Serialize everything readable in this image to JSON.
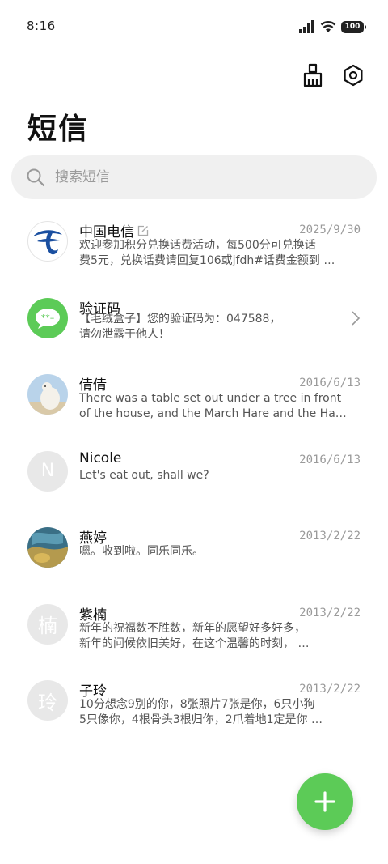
{
  "status": {
    "time": "8:16",
    "battery": "100"
  },
  "header": {
    "title": "短信"
  },
  "search": {
    "placeholder": "搜索短信"
  },
  "conversations": [
    {
      "name": "中国电信",
      "date": "2025/9/30",
      "line1": "欢迎参加积分兑换话费活动，每500分可兑换话",
      "line2": "费5元，兑换话费请回复106或jfdh#话费金额到 …"
    },
    {
      "name": "验证码",
      "date": "",
      "line1": "【毛绒盒子】您的验证码为：047588，",
      "line2": "请勿泄露于他人！"
    },
    {
      "name": "倩倩",
      "date": "2016/6/13",
      "line1": "There was a table set out under a tree in front",
      "line2": "of the house, and the March Hare and the Hatt …"
    },
    {
      "name": "Nicole",
      "date": "2016/6/13",
      "initial": "N",
      "line1": "Let's eat out, shall we?",
      "line2": ""
    },
    {
      "name": "燕婷",
      "date": "2013/2/22",
      "line1": "嗯。收到啦。同乐同乐。",
      "line2": ""
    },
    {
      "name": "紫楠",
      "date": "2013/2/22",
      "initial": "楠",
      "line1": "新年的祝福数不胜数，新年的愿望好多好多，",
      "line2": "新年的问候依旧美好，在这个温馨的时刻， …"
    },
    {
      "name": "子玲",
      "date": "2013/2/22",
      "initial": "玲",
      "line1": "10分想念9别的你，8张照片7张是你，6只小狗",
      "line2": "5只像你，4根骨头3根归你，2爪着地1定是你 …"
    }
  ],
  "colors": {
    "accent": "#5ccb57",
    "telecom_blue": "#1a4fa0"
  },
  "icons": {
    "header": [
      "broom-icon",
      "settings-icon"
    ],
    "search": "search-icon",
    "fab": "plus-icon"
  }
}
